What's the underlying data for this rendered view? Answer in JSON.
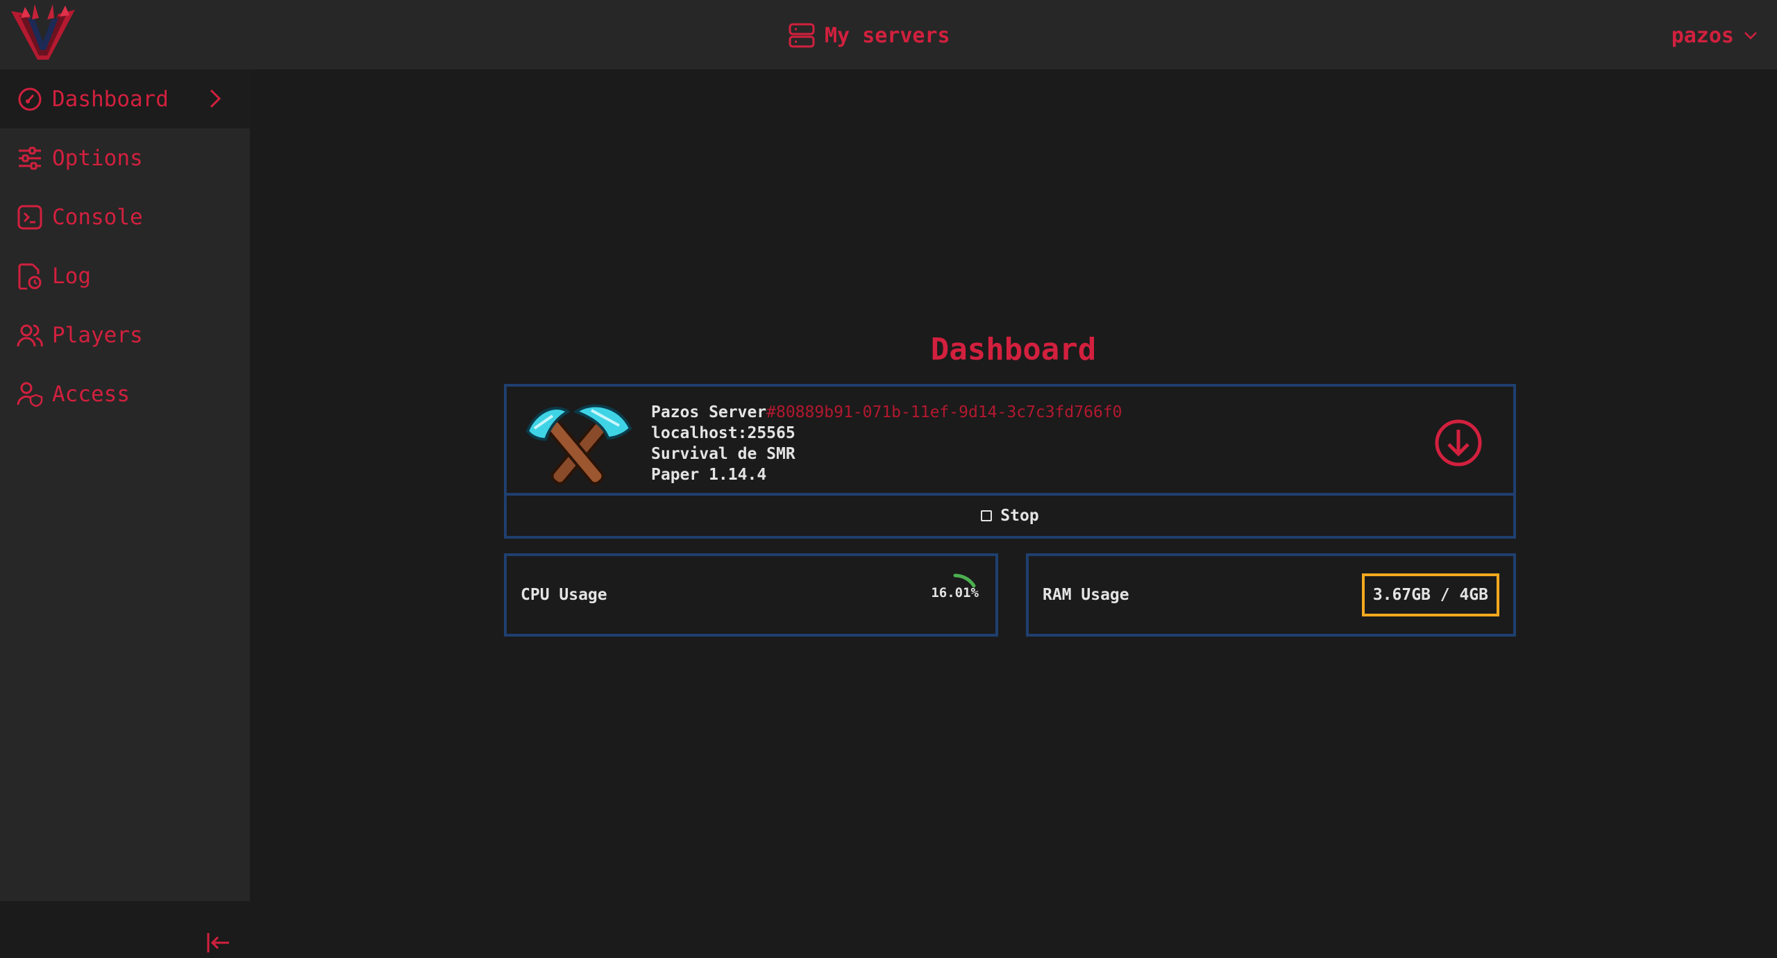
{
  "header": {
    "title": "My servers",
    "user": "pazos"
  },
  "sidebar": {
    "items": [
      {
        "label": "Dashboard",
        "icon": "gauge-icon",
        "active": true
      },
      {
        "label": "Options",
        "icon": "sliders-icon"
      },
      {
        "label": "Console",
        "icon": "terminal-icon"
      },
      {
        "label": "Log",
        "icon": "file-clock-icon"
      },
      {
        "label": "Players",
        "icon": "users-icon"
      },
      {
        "label": "Access",
        "icon": "user-shield-icon"
      }
    ]
  },
  "main": {
    "title": "Dashboard",
    "server": {
      "name": "Pazos Server",
      "uuid": "#80889b91-071b-11ef-9d14-3c7c3fd766f0",
      "address": "localhost:25565",
      "description": "Survival de SMR",
      "version": "Paper 1.14.4"
    },
    "stop_label": "Stop",
    "cpu": {
      "label": "CPU Usage",
      "value": "16.01%",
      "percent": 16.01
    },
    "ram": {
      "label": "RAM Usage",
      "value": "3.67GB / 4GB"
    }
  },
  "colors": {
    "accent": "#d2203e",
    "card_border": "#1f3f6f",
    "ram_highlight": "#f3a91f",
    "cpu_gauge": "#4caf50",
    "background": "#1b1b1b",
    "panel": "#272727"
  }
}
